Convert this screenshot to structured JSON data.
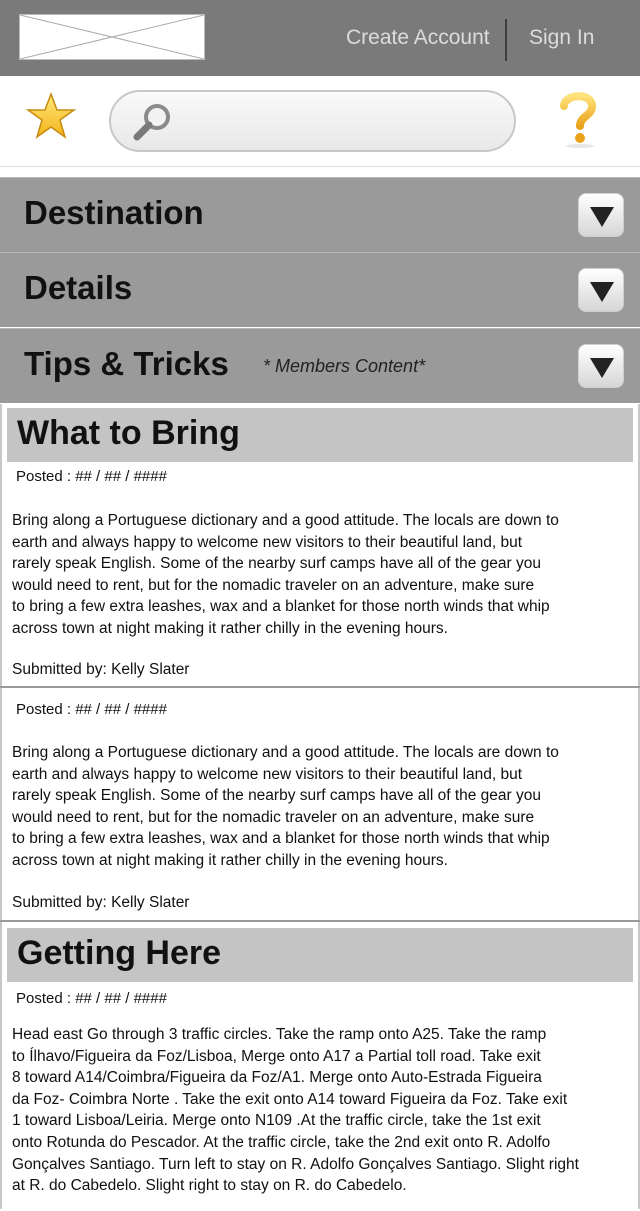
{
  "header": {
    "create_account": "Create Account",
    "sign_in": "Sign In"
  },
  "search": {
    "placeholder": "",
    "value": ""
  },
  "icons": {
    "favorite": "star-icon",
    "search": "magnifier-icon",
    "help": "question-mark-icon"
  },
  "accordion": [
    {
      "label": "Destination",
      "note": ""
    },
    {
      "label": "Details",
      "note": ""
    },
    {
      "label": "Tips & Tricks",
      "note": "* Members Content*"
    }
  ],
  "sections": {
    "what_to_bring": {
      "title": "What to Bring",
      "posts": [
        {
          "posted": "Posted : ## / ## / ####",
          "body": "Bring along a Portuguese dictionary and a good attitude. The locals are down to\n earth and always happy to welcome new visitors to their beautiful land, but\n rarely speak English. Some of the nearby surf camps have all of the gear you\nwould need to rent, but for the nomadic traveler on an adventure, make sure\n to bring a few extra leashes, wax and a blanket for those north winds that whip\n across town at night making it rather chilly in the evening hours.",
          "submitted": "Submitted by: Kelly Slater"
        },
        {
          "posted": "Posted : ## / ## / ####",
          "body": "Bring along a Portuguese dictionary and a good attitude. The locals are down to\n earth and always happy to welcome new visitors to their beautiful land, but\n rarely speak English. Some of the nearby surf camps have all of the gear you\nwould need to rent, but for the nomadic traveler on an adventure, make sure\n to bring a few extra leashes, wax and a blanket for those north winds that whip\n across town at night making it rather chilly in the evening hours.",
          "submitted": "Submitted by: Kelly Slater"
        }
      ]
    },
    "getting_here": {
      "title": "Getting Here",
      "posted": "Posted : ## / ## / ####",
      "body": "Head east Go through 3 traffic circles. Take the ramp onto A25. Take the ramp\n to Ílhavo/Figueira da Foz/Lisboa, Merge onto A17 a Partial toll road. Take exit\n 8 toward A14/Coimbra/Figueira da Foz/A1. Merge onto Auto-Estrada Figueira\n da Foz- Coimbra Norte . Take the exit onto A14 toward Figueira da Foz. Take exit\n1 toward Lisboa/Leiria. Merge onto N109 .At the traffic circle, take the 1st exit\nonto Rotunda do Pescador. At the traffic circle, take the 2nd exit onto R. Adolfo\nGonçalves Santiago. Turn left to stay on R. Adolfo Gonçalves Santiago. Slight right\nat R. do Cabedelo. Slight right to stay on R. do Cabedelo."
    }
  }
}
